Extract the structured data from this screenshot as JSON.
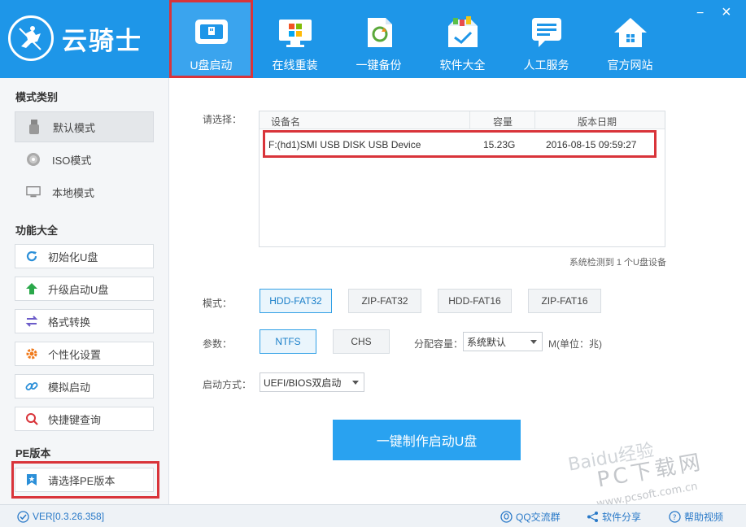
{
  "app": {
    "logo_text": "云骑士",
    "window_controls": {
      "minimize": "−",
      "close": "×"
    }
  },
  "nav": {
    "items": [
      {
        "label": "U盘启动",
        "icon": "usb-drive-icon",
        "active": true
      },
      {
        "label": "在线重装",
        "icon": "windows-monitor-icon"
      },
      {
        "label": "一键备份",
        "icon": "backup-doc-icon"
      },
      {
        "label": "软件大全",
        "icon": "software-box-icon"
      },
      {
        "label": "人工服务",
        "icon": "chat-bubble-icon"
      },
      {
        "label": "官方网站",
        "icon": "home-icon"
      }
    ]
  },
  "sidebar": {
    "mode_title": "模式类别",
    "modes": [
      {
        "label": "默认模式",
        "icon": "usb-stick-icon",
        "selected": true
      },
      {
        "label": "ISO模式",
        "icon": "disc-icon"
      },
      {
        "label": "本地模式",
        "icon": "monitor-icon"
      }
    ],
    "func_title": "功能大全",
    "functions": [
      {
        "label": "初始化U盘",
        "icon": "refresh-icon"
      },
      {
        "label": "升级启动U盘",
        "icon": "arrow-up-icon"
      },
      {
        "label": "格式转换",
        "icon": "swap-icon"
      },
      {
        "label": "个性化设置",
        "icon": "gear-icon"
      },
      {
        "label": "模拟启动",
        "icon": "link-icon"
      },
      {
        "label": "快捷键查询",
        "icon": "search-icon"
      }
    ],
    "pe_title": "PE版本",
    "pe_button": "请选择PE版本"
  },
  "main": {
    "select_label": "请选择：",
    "table": {
      "headers": [
        "设备名",
        "容量",
        "版本日期"
      ],
      "rows": [
        {
          "device": "F:(hd1)SMI USB DISK USB Device",
          "capacity": "15.23G",
          "date": "2016-08-15 09:59:27"
        }
      ]
    },
    "detect_text": "系统检测到 1 个U盘设备",
    "mode_label": "模式：",
    "mode_options": [
      "HDD-FAT32",
      "ZIP-FAT32",
      "HDD-FAT16",
      "ZIP-FAT16"
    ],
    "param_label": "参数：",
    "param_options": [
      "NTFS",
      "CHS"
    ],
    "alloc_label": "分配容量：",
    "alloc_value": "系统默认",
    "alloc_unit": "M(单位：兆)",
    "boot_label": "启动方式：",
    "boot_value": "UEFI/BIOS双启动",
    "make_button": "一键制作启动U盘"
  },
  "watermark": {
    "line1": "Baidu经验",
    "line2": "PC下载网",
    "line3": "www.pcsoft.com.cn"
  },
  "footer": {
    "version": "VER[0.3.26.358]",
    "qq": "QQ交流群",
    "share": "软件分享",
    "help": "帮助视频"
  },
  "colors": {
    "accent": "#1e96e8",
    "highlight_border": "#d9343a",
    "button": "#29a2f0"
  }
}
